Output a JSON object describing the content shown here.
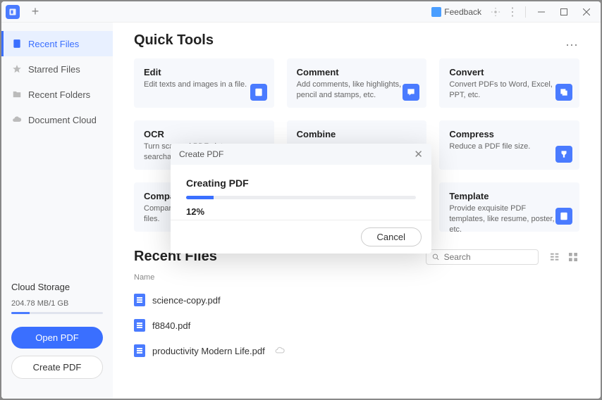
{
  "titlebar": {
    "feedback": "Feedback"
  },
  "sidebar": {
    "items": [
      {
        "label": "Recent Files"
      },
      {
        "label": "Starred Files"
      },
      {
        "label": "Recent Folders"
      },
      {
        "label": "Document Cloud"
      }
    ],
    "cloud_label": "Cloud Storage",
    "cloud_usage": "204.78 MB/1 GB",
    "open_label": "Open PDF",
    "create_label": "Create PDF"
  },
  "quick_tools": {
    "title": "Quick Tools",
    "cards": [
      {
        "title": "Edit",
        "desc": "Edit texts and images in a file."
      },
      {
        "title": "Comment",
        "desc": "Add comments, like highlights, pencil and stamps, etc."
      },
      {
        "title": "Convert",
        "desc": "Convert PDFs to Word, Excel, PPT, etc."
      },
      {
        "title": "OCR",
        "desc": "Turn scanned PDFs into searchable documents."
      },
      {
        "title": "Combine",
        "desc": ""
      },
      {
        "title": "Compress",
        "desc": "Reduce a PDF file size."
      },
      {
        "title": "Compare",
        "desc": "Compare differences between files."
      },
      {
        "title": "",
        "desc": ""
      },
      {
        "title": "Template",
        "desc": "Provide exquisite PDF templates, like resume, poster, etc."
      }
    ]
  },
  "recent": {
    "title": "Recent Files",
    "search_placeholder": "Search",
    "header_name": "Name",
    "files": [
      {
        "name": "science-copy.pdf"
      },
      {
        "name": "f8840.pdf"
      },
      {
        "name": "productivity Modern Life.pdf"
      }
    ]
  },
  "modal": {
    "header": "Create PDF",
    "title": "Creating PDF",
    "percent_val": 12,
    "percent": "12%",
    "cancel": "Cancel"
  }
}
